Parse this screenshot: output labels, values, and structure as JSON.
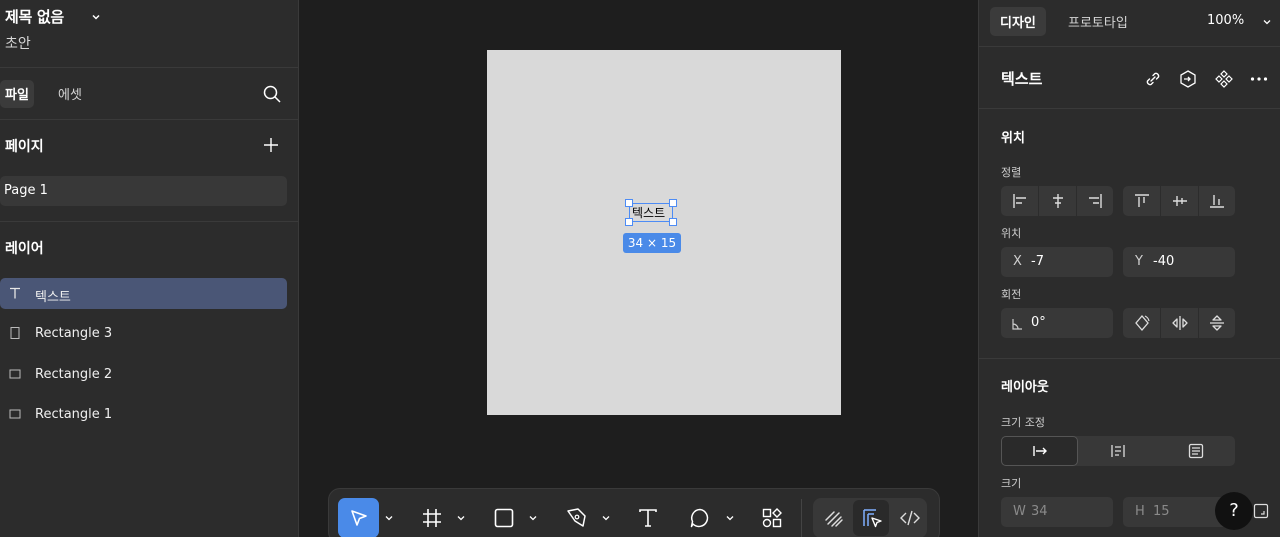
{
  "file": {
    "title": "제목 없음",
    "status": "초안"
  },
  "left_tabs": {
    "files": "파일",
    "assets": "에셋"
  },
  "pages": {
    "title": "페이지",
    "items": [
      "Page 1"
    ]
  },
  "layers": {
    "title": "레이어",
    "items": [
      {
        "label": "텍스트",
        "icon": "text-icon",
        "selected": true
      },
      {
        "label": "Rectangle 3",
        "icon": "rectangle-icon",
        "selected": false
      },
      {
        "label": "Rectangle 2",
        "icon": "rectangle-icon",
        "selected": false
      },
      {
        "label": "Rectangle 1",
        "icon": "rectangle-icon",
        "selected": false
      }
    ]
  },
  "canvas": {
    "text_content": "텍스트",
    "size_badge": "34 × 15"
  },
  "toolbar": {
    "tools": [
      "move-icon",
      "frame-icon",
      "rectangle-icon",
      "pen-icon",
      "text-icon",
      "comment-icon",
      "actions-icon",
      "draw-icon",
      "dev-mode-icon",
      "code-icon"
    ],
    "accent": "#4a8ae8"
  },
  "right_tabs": {
    "design": "디자인",
    "prototype": "프로토타입",
    "zoom": "100%"
  },
  "selection": {
    "title": "텍스트"
  },
  "position": {
    "title": "위치",
    "align_label": "정렬",
    "position_label": "위치",
    "x_label": "X",
    "x_value": "-7",
    "y_label": "Y",
    "y_value": "-40",
    "rotation_label": "회전",
    "rotation_value": "0°"
  },
  "layout": {
    "title": "레이아웃",
    "resizing_label": "크기 조정",
    "size_label": "크기",
    "w_label": "W",
    "w_value": "34",
    "h_label": "H",
    "h_value": "15"
  },
  "help": "?"
}
